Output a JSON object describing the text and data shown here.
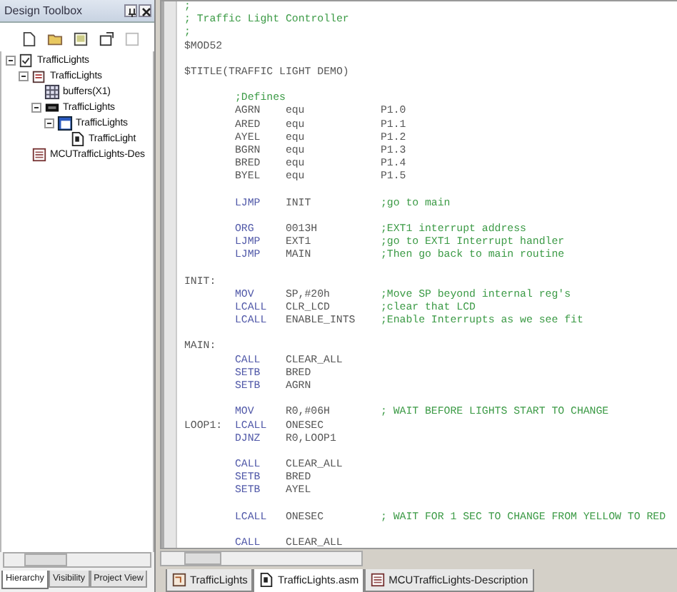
{
  "toolbox": {
    "title": "Design Toolbox",
    "tree": [
      {
        "label": "TrafficLights",
        "kind": "project",
        "expanded": true,
        "children": [
          {
            "label": "TrafficLights",
            "kind": "folder",
            "expanded": true,
            "children": [
              {
                "label": "buffers(X1)",
                "kind": "grid"
              },
              {
                "label": "TrafficLights",
                "kind": "chip",
                "expanded": true,
                "children": [
                  {
                    "label": "TrafficLights",
                    "kind": "window",
                    "expanded": true,
                    "children": [
                      {
                        "label": "TrafficLight",
                        "kind": "file"
                      }
                    ]
                  }
                ]
              }
            ]
          },
          {
            "label": "MCUTrafficLights-Des",
            "kind": "doc"
          }
        ]
      }
    ],
    "tabs": [
      {
        "label": "Hierarchy",
        "selected": true
      },
      {
        "label": "Visibility",
        "selected": false
      },
      {
        "label": "Project View",
        "selected": false
      }
    ]
  },
  "editor": {
    "lines": [
      {
        "kind": "comment",
        "text": ";"
      },
      {
        "kind": "comment",
        "text": "; Traffic Light Controller"
      },
      {
        "kind": "comment",
        "text": ";"
      },
      {
        "kind": "text",
        "text": "$MOD52"
      },
      {
        "kind": "blank"
      },
      {
        "kind": "text",
        "text": "$TITLE(TRAFFIC LIGHT DEMO)"
      },
      {
        "kind": "blank"
      },
      {
        "kind": "code",
        "comment": ";Defines"
      },
      {
        "kind": "code",
        "op": "AGRN",
        "arg": "equ",
        "extra": "P1.0"
      },
      {
        "kind": "code",
        "op": "ARED",
        "arg": "equ",
        "extra": "P1.1"
      },
      {
        "kind": "code",
        "op": "AYEL",
        "arg": "equ",
        "extra": "P1.2"
      },
      {
        "kind": "code",
        "op": "BGRN",
        "arg": "equ",
        "extra": "P1.3"
      },
      {
        "kind": "code",
        "op": "BRED",
        "arg": "equ",
        "extra": "P1.4"
      },
      {
        "kind": "code",
        "op": "BYEL",
        "arg": "equ",
        "extra": "P1.5"
      },
      {
        "kind": "blank"
      },
      {
        "kind": "code",
        "op": "LJMP",
        "arg": "INIT",
        "comment": ";go to main"
      },
      {
        "kind": "blank"
      },
      {
        "kind": "code",
        "op": "ORG",
        "arg": "0013H",
        "comment": ";EXT1 interrupt address"
      },
      {
        "kind": "code",
        "op": "LJMP",
        "arg": "EXT1",
        "comment": ";go to EXT1 Interrupt handler"
      },
      {
        "kind": "code",
        "op": "LJMP",
        "arg": "MAIN",
        "comment": ";Then go back to main routine"
      },
      {
        "kind": "blank"
      },
      {
        "kind": "code",
        "label": "INIT:"
      },
      {
        "kind": "code",
        "op": "MOV",
        "arg": "SP,#20h",
        "comment": ";Move SP beyond internal reg's"
      },
      {
        "kind": "code",
        "op": "LCALL",
        "arg": "CLR_LCD",
        "comment": ";clear that LCD"
      },
      {
        "kind": "code",
        "op": "LCALL",
        "arg": "ENABLE_INTS",
        "comment": ";Enable Interrupts as we see fit"
      },
      {
        "kind": "blank"
      },
      {
        "kind": "code",
        "label": "MAIN:"
      },
      {
        "kind": "code",
        "op": "CALL",
        "arg": "CLEAR_ALL"
      },
      {
        "kind": "code",
        "op": "SETB",
        "arg": "BRED"
      },
      {
        "kind": "code",
        "op": "SETB",
        "arg": "AGRN"
      },
      {
        "kind": "blank"
      },
      {
        "kind": "code",
        "op": "MOV",
        "arg": "R0,#06H",
        "comment": "; WAIT BEFORE LIGHTS START TO CHANGE"
      },
      {
        "kind": "code",
        "label": "LOOP1:",
        "op": "LCALL",
        "arg": "ONESEC"
      },
      {
        "kind": "code",
        "op": "DJNZ",
        "arg": "R0,LOOP1"
      },
      {
        "kind": "blank"
      },
      {
        "kind": "code",
        "op": "CALL",
        "arg": "CLEAR_ALL"
      },
      {
        "kind": "code",
        "op": "SETB",
        "arg": "BRED"
      },
      {
        "kind": "code",
        "op": "SETB",
        "arg": "AYEL"
      },
      {
        "kind": "blank"
      },
      {
        "kind": "code",
        "op": "LCALL",
        "arg": "ONESEC",
        "comment": "; WAIT FOR 1 SEC TO CHANGE FROM YELLOW TO RED"
      },
      {
        "kind": "blank"
      },
      {
        "kind": "code",
        "op": "CALL",
        "arg": "CLEAR_ALL"
      }
    ],
    "tabs": [
      {
        "label": "TrafficLights",
        "kind": "schematic",
        "selected": false
      },
      {
        "label": "TrafficLights.asm",
        "kind": "file",
        "selected": true
      },
      {
        "label": "MCUTrafficLights-Description",
        "kind": "doc",
        "selected": false
      }
    ]
  }
}
